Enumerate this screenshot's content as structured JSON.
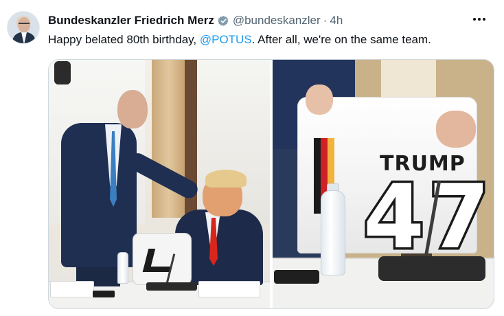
{
  "tweet": {
    "display_name": "Bundeskanzler Friedrich Merz",
    "handle": "@bundeskanzler",
    "separator": "·",
    "timestamp": "4h",
    "text_before": "Happy belated 80th birthday, ",
    "mention": "@POTUS",
    "text_after": ". After all, we're on the same team."
  },
  "media": {
    "jersey_name": "TRUMP",
    "jersey_number": "47"
  },
  "colors": {
    "mention": "#1d9bf0",
    "verified_badge": "#829aab",
    "secondary_text": "#536471",
    "primary_text": "#0f1419"
  },
  "icons": {
    "verified": "verified-badge-icon",
    "more": "more-options-icon"
  }
}
